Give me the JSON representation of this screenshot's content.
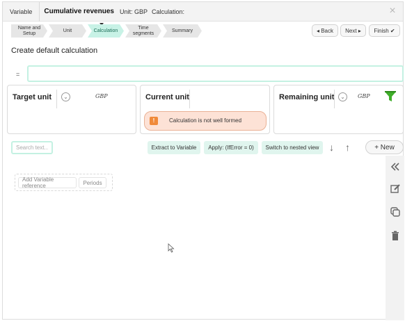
{
  "titlebar": {
    "variable_label": "Variable",
    "name": "Cumulative revenues",
    "unit_text": "Unit: GBP",
    "calculation_text": "Calculation:",
    "close_glyph": "×"
  },
  "steps": [
    {
      "label_line1": "Name and",
      "label_line2": "Setup",
      "active": false
    },
    {
      "label_line1": "Unit",
      "label_line2": "",
      "active": false
    },
    {
      "label_line1": "Calculation",
      "label_line2": "",
      "active": true
    },
    {
      "label_line1": "Time",
      "label_line2": "segments",
      "active": false
    },
    {
      "label_line1": "Summary",
      "label_line2": "",
      "active": false
    }
  ],
  "nav": {
    "back_label": "◂ Back",
    "next_label": "Next ▸",
    "finish_label": "Finish ✔"
  },
  "heading": "Create default calculation",
  "formula": {
    "equals": "=",
    "value": ""
  },
  "cards": {
    "target": {
      "title": "Target unit",
      "unit": "GBP"
    },
    "current": {
      "title": "Current unit",
      "error": "Calculation is not well formed",
      "error_icon": "!"
    },
    "remaining": {
      "title": "Remaining unit",
      "unit": "GBP"
    }
  },
  "toolbar": {
    "search_placeholder": "Search text...",
    "extract_label": "Extract to Variable",
    "apply_label": "Apply: (IfError = 0)",
    "nested_label": "Switch to nested view",
    "down_glyph": "↓",
    "up_glyph": "↑",
    "new_label": "+ New"
  },
  "references": {
    "add_variable_label": "Add Variable reference",
    "periods_label": "Periods"
  },
  "sidepanel": {
    "icons": [
      "collapse-icon",
      "edit-icon",
      "duplicate-icon",
      "delete-icon"
    ]
  },
  "colors": {
    "accent_mint": "#c4f1e2",
    "active_step": "#c8f2e6",
    "error_bg": "#fde2d6",
    "error_icon": "#f08a3a",
    "funnel_green": "#3fae2a"
  }
}
